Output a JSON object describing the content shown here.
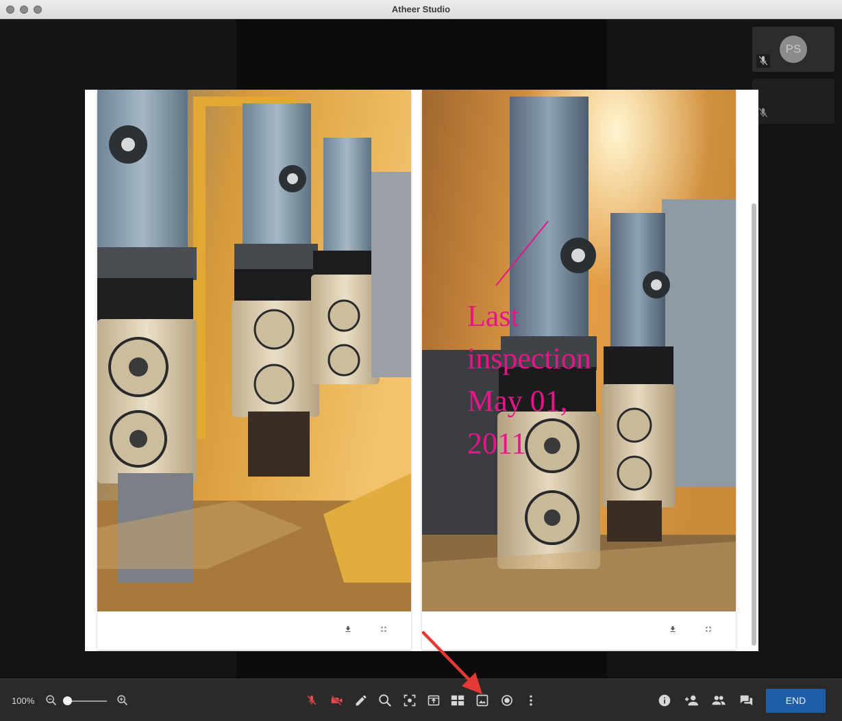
{
  "window": {
    "title": "Atheer Studio"
  },
  "participants": [
    {
      "initials": "PS",
      "mic_icon": "mic-muted-icon"
    },
    {
      "initials": "",
      "mic_icon": "mic-muted-icon"
    }
  ],
  "gallery": {
    "cards": [
      {
        "photo": "industrial-valves-photo",
        "actions": [
          "download-icon",
          "fullscreen-icon"
        ]
      },
      {
        "photo": "industrial-valves-annotated-photo",
        "annotation": "Last inspection May 01, 2011",
        "annotation_color": "#e6168a",
        "actions": [
          "download-icon",
          "fullscreen-icon"
        ]
      }
    ]
  },
  "toolbar": {
    "zoom_label": "100%",
    "zoom_level_percent": 100,
    "tools": [
      "mic-muted-icon",
      "camera-off-icon",
      "pen-icon",
      "zoom-icon",
      "screenshot-icon",
      "share-screen-icon",
      "layout-icon",
      "gallery-icon",
      "record-icon",
      "more-icon",
      "info-icon",
      "add-person-icon",
      "participants-icon",
      "chat-icon"
    ],
    "end_label": "END",
    "colors": {
      "muted": "#e24a4a",
      "icon": "#d6d6d6",
      "end_button": "#1e5ea8"
    }
  }
}
